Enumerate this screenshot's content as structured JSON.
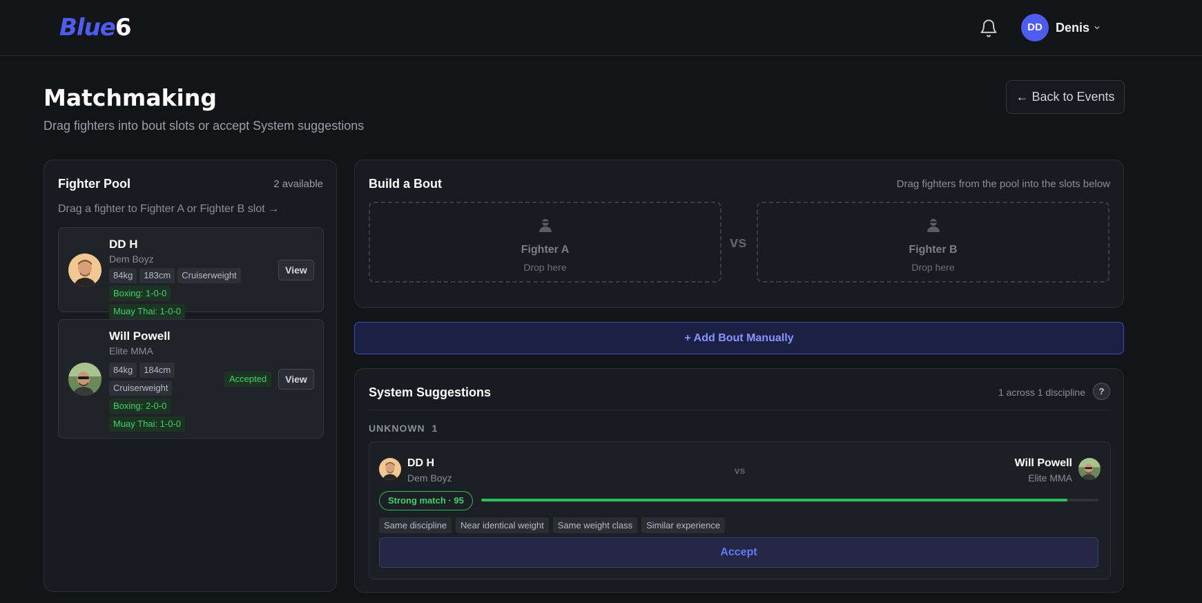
{
  "header": {
    "logo_part1": "Blue",
    "logo_part2": "6",
    "user_initials": "DD",
    "user_name": "Denis"
  },
  "page": {
    "title": "Matchmaking",
    "subtitle": "Drag fighters into bout slots or accept System suggestions",
    "back_label": "← Back to Events"
  },
  "pool": {
    "title": "Fighter Pool",
    "count": "2 available",
    "hint": "Drag a fighter to Fighter A or Fighter B slot →",
    "fighters": [
      {
        "name": "DD H",
        "team": "Dem Boyz",
        "tags": [
          "84kg",
          "183cm",
          "Cruiserweight"
        ],
        "records": [
          "Boxing: 1-0-0",
          "Muay Thai: 1-0-0"
        ],
        "view_label": "View"
      },
      {
        "name": "Will Powell",
        "team": "Elite MMA",
        "tags": [
          "84kg",
          "184cm",
          "Cruiserweight"
        ],
        "records": [
          "Boxing: 2-0-0",
          "Muay Thai: 1-0-0"
        ],
        "status": "Accepted",
        "view_label": "View"
      }
    ]
  },
  "build": {
    "title": "Build a Bout",
    "hint": "Drag fighters from the pool into the slots below",
    "slot_a_label": "Fighter A",
    "slot_b_label": "Fighter B",
    "drop_label": "Drop here",
    "vs_label": "vs"
  },
  "add_bout_label": "+ Add Bout Manually",
  "suggestions": {
    "title": "System Suggestions",
    "count": "1 across 1 discipline",
    "help_label": "?",
    "group_name": "UNKNOWN",
    "group_count": "1",
    "match": {
      "fighter_a_name": "DD H",
      "fighter_a_team": "Dem Boyz",
      "fighter_b_name": "Will Powell",
      "fighter_b_team": "Elite MMA",
      "vs_label": "vs",
      "score_label": "Strong match · 95",
      "score_value": 95,
      "reasons": [
        "Same discipline",
        "Near identical weight",
        "Same weight class",
        "Similar experience"
      ],
      "accept_label": "Accept"
    }
  },
  "colors": {
    "accent": "#4f5cf0",
    "success": "#2fbf5d",
    "background": "#121418"
  }
}
